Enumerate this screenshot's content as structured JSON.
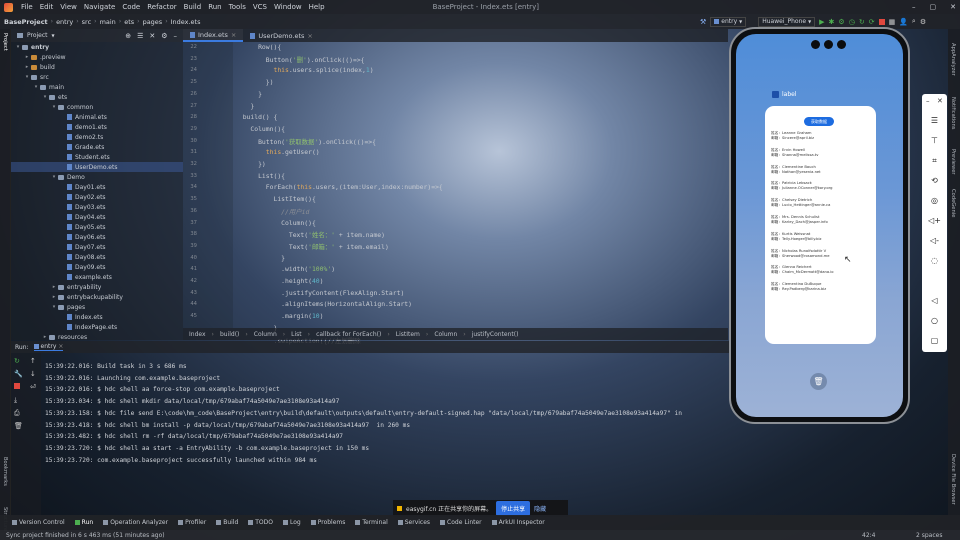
{
  "menubar": {
    "items": [
      "File",
      "Edit",
      "View",
      "Navigate",
      "Code",
      "Refactor",
      "Build",
      "Run",
      "Tools",
      "VCS",
      "Window",
      "Help"
    ],
    "title": "BaseProject - Index.ets [entry]"
  },
  "nav": {
    "crumbs": [
      "BaseProject",
      "entry",
      "src",
      "main",
      "ets",
      "pages",
      "Index.ets"
    ],
    "module": "entry",
    "device": "Huawei_Phone"
  },
  "project": {
    "label": "Project",
    "tree": [
      {
        "name": "entry",
        "depth": 0,
        "type": "folder",
        "open": true,
        "bold": true
      },
      {
        "name": ".preview",
        "depth": 1,
        "type": "folder",
        "orange": true
      },
      {
        "name": "build",
        "depth": 1,
        "type": "folder",
        "orange": true
      },
      {
        "name": "src",
        "depth": 1,
        "type": "folder",
        "open": true
      },
      {
        "name": "main",
        "depth": 2,
        "type": "folder",
        "open": true
      },
      {
        "name": "ets",
        "depth": 3,
        "type": "folder",
        "open": true
      },
      {
        "name": "common",
        "depth": 4,
        "type": "folder",
        "open": true
      },
      {
        "name": "Animal.ets",
        "depth": 5,
        "type": "file"
      },
      {
        "name": "demo1.ets",
        "depth": 5,
        "type": "file"
      },
      {
        "name": "demo2.ts",
        "depth": 5,
        "type": "file"
      },
      {
        "name": "Grade.ets",
        "depth": 5,
        "type": "file"
      },
      {
        "name": "Student.ets",
        "depth": 5,
        "type": "file"
      },
      {
        "name": "UserDemo.ets",
        "depth": 5,
        "type": "file",
        "selected": true
      },
      {
        "name": "Demo",
        "depth": 4,
        "type": "folder",
        "open": true
      },
      {
        "name": "Day01.ets",
        "depth": 5,
        "type": "file"
      },
      {
        "name": "Day02.ets",
        "depth": 5,
        "type": "file"
      },
      {
        "name": "Day03.ets",
        "depth": 5,
        "type": "file"
      },
      {
        "name": "Day04.ets",
        "depth": 5,
        "type": "file"
      },
      {
        "name": "Day05.ets",
        "depth": 5,
        "type": "file"
      },
      {
        "name": "Day06.ets",
        "depth": 5,
        "type": "file"
      },
      {
        "name": "Day07.ets",
        "depth": 5,
        "type": "file"
      },
      {
        "name": "Day08.ets",
        "depth": 5,
        "type": "file"
      },
      {
        "name": "Day09.ets",
        "depth": 5,
        "type": "file"
      },
      {
        "name": "example.ets",
        "depth": 5,
        "type": "file"
      },
      {
        "name": "entryability",
        "depth": 4,
        "type": "folder"
      },
      {
        "name": "entrybackupability",
        "depth": 4,
        "type": "folder"
      },
      {
        "name": "pages",
        "depth": 4,
        "type": "folder",
        "open": true
      },
      {
        "name": "Index.ets",
        "depth": 5,
        "type": "file"
      },
      {
        "name": "IndexPage.ets",
        "depth": 5,
        "type": "file"
      },
      {
        "name": "resources",
        "depth": 3,
        "type": "folder"
      }
    ]
  },
  "editor": {
    "tabs": [
      "Index.ets",
      "UserDemo.ets"
    ],
    "line_numbers": [
      "22",
      "23",
      "24",
      "25",
      "26",
      "27",
      "28",
      "29",
      "30",
      "31",
      "32",
      "33",
      "34",
      "35",
      "36",
      "37",
      "38",
      "39",
      "40",
      "41",
      "42",
      "43",
      "44",
      "45"
    ],
    "lines": [
      [
        {
          "t": "      Row(){",
          "c": ""
        }
      ],
      [
        {
          "t": "        Button(",
          "c": ""
        },
        {
          "t": "'删'",
          "c": "s"
        },
        {
          "t": ").onClick(()=>{",
          "c": ""
        }
      ],
      [
        {
          "t": "          ",
          "c": ""
        },
        {
          "t": "this",
          "c": "k"
        },
        {
          "t": ".users.splice(index,",
          "c": ""
        },
        {
          "t": "1",
          "c": "n"
        },
        {
          "t": ")",
          "c": ""
        }
      ],
      [
        {
          "t": "        })",
          "c": ""
        }
      ],
      [
        {
          "t": "      }",
          "c": ""
        }
      ],
      [
        {
          "t": "    }",
          "c": ""
        }
      ],
      [
        {
          "t": "  build() {",
          "c": ""
        }
      ],
      [
        {
          "t": "    Column(){",
          "c": ""
        }
      ],
      [
        {
          "t": "      Button(",
          "c": ""
        },
        {
          "t": "'获取数据'",
          "c": "s"
        },
        {
          "t": ").onClick(()=>{",
          "c": ""
        }
      ],
      [
        {
          "t": "        ",
          "c": ""
        },
        {
          "t": "this",
          "c": "k"
        },
        {
          "t": ".getUser()",
          "c": ""
        }
      ],
      [
        {
          "t": "      })",
          "c": ""
        }
      ],
      [
        {
          "t": "      List(){",
          "c": ""
        }
      ],
      [
        {
          "t": "        ForEach(",
          "c": ""
        },
        {
          "t": "this",
          "c": "k"
        },
        {
          "t": ".users,(item:User,index:number)=>{",
          "c": ""
        }
      ],
      [
        {
          "t": "          ListItem(){",
          "c": ""
        }
      ],
      [
        {
          "t": "            //用户id",
          "c": "c"
        }
      ],
      [
        {
          "t": "            Column(){",
          "c": ""
        }
      ],
      [
        {
          "t": "              Text(",
          "c": ""
        },
        {
          "t": "'姓名：'",
          "c": "s"
        },
        {
          "t": " + item.name)",
          "c": ""
        }
      ],
      [
        {
          "t": "              Text(",
          "c": ""
        },
        {
          "t": "'邮箱：'",
          "c": "s"
        },
        {
          "t": " + item.email)",
          "c": ""
        }
      ],
      [
        {
          "t": "            }",
          "c": ""
        }
      ],
      [
        {
          "t": "            .width(",
          "c": ""
        },
        {
          "t": "'100%'",
          "c": "s"
        },
        {
          "t": ")",
          "c": ""
        }
      ],
      [
        {
          "t": "            .height(",
          "c": ""
        },
        {
          "t": "40",
          "c": "n"
        },
        {
          "t": ")",
          "c": ""
        }
      ],
      [
        {
          "t": "            .justifyContent(FlexAlign.Start)",
          "c": ""
        }
      ],
      [
        {
          "t": "            .alignItems(HorizontalAlign.Start)",
          "c": ""
        }
      ],
      [
        {
          "t": "            .margin(",
          "c": ""
        },
        {
          "t": "10",
          "c": "n"
        },
        {
          "t": ")",
          "c": ""
        }
      ],
      [
        {
          "t": "          }",
          "c": ""
        }
      ],
      [
        {
          "t": "          .swipeAction({//左划删除",
          "c": ""
        }
      ]
    ],
    "breadcrumb": [
      "Index",
      "build()",
      "Column",
      "List",
      "callback for ForEach()",
      "ListItem",
      "Column",
      "justifyContent()"
    ]
  },
  "run": {
    "label": "Run:",
    "config": "entry",
    "lines": [
      "15:39:22.016: Build task in 3 s 686 ms",
      "15:39:22.016: Launching com.example.baseproject",
      "15:39:22.016: $ hdc shell aa force-stop com.example.baseproject",
      "15:39:23.034: $ hdc shell mkdir data/local/tmp/679abaf74a5049e7ae3108e93a414a97",
      "15:39:23.158: $ hdc file send E:\\code\\hm_code\\BaseProject\\entry\\build\\default\\outputs\\default\\entry-default-signed.hap \"data/local/tmp/679abaf74a5049e7ae3108e93a414a97\" in",
      "15:39:23.418: $ hdc shell bm install -p data/local/tmp/679abaf74a5049e7ae3108e93a414a97  in 260 ms",
      "15:39:23.482: $ hdc shell rm -rf data/local/tmp/679abaf74a5049e7ae3108e93a414a97",
      "15:39:23.720: $ hdc shell aa start -a EntryAbility -b com.example.baseproject in 150 ms",
      "15:39:23.720: com.example.baseproject successfully launched within 984 ms"
    ]
  },
  "tools": [
    "Version Control",
    "Run",
    "Operation Analyzer",
    "Profiler",
    "Build",
    "TODO",
    "Log",
    "Problems",
    "Terminal",
    "Services",
    "Code Linter",
    "ArkUI Inspector"
  ],
  "status": {
    "text": "Sync project finished in 6 s 463 ms (51 minutes ago)",
    "pos": "42:4",
    "indent": "2 spaces"
  },
  "right_strip": [
    "AppAnalyzer",
    "Notifications",
    "Previewer",
    "CodeGenie"
  ],
  "right_strip_bottom": "Device File Browser",
  "left_strip": [
    "Project",
    "Bookmarks",
    "Structure"
  ],
  "phone": {
    "app_label": "label",
    "button": "获取数据",
    "users": [
      {
        "name": "姓名：Leanne Graham",
        "email": "邮箱：Sincere@april.biz"
      },
      {
        "name": "姓名：Ervin Howell",
        "email": "邮箱：Shanna@melissa.tv"
      },
      {
        "name": "姓名：Clementine Bauch",
        "email": "邮箱：Nathan@yesenia.net"
      },
      {
        "name": "姓名：Patricia Lebsack",
        "email": "邮箱：Julianne.OConner@kory.org"
      },
      {
        "name": "姓名：Chelsey Dietrich",
        "email": "邮箱：Lucio_Hettinger@annie.ca"
      },
      {
        "name": "姓名：Mrs. Dennis Schulist",
        "email": "邮箱：Karley_Dach@jasper.info"
      },
      {
        "name": "姓名：Kurtis Weissnat",
        "email": "邮箱：Telly.Hoeger@billy.biz"
      },
      {
        "name": "姓名：Nicholas Runolfsdottir V",
        "email": "邮箱：Sherwood@rosamond.me"
      },
      {
        "name": "姓名：Glenna Reichert",
        "email": "邮箱：Chaim_McDermott@dana.io"
      },
      {
        "name": "姓名：Clementina DuBuque",
        "email": "邮箱：Rey.Padberg@karina.biz"
      }
    ]
  },
  "share": {
    "text": "easygif.cn 正在共享你的屏幕。",
    "stop": "停止共享",
    "hide": "隐藏"
  },
  "colors": {
    "accent": "#3b7be0",
    "phone_button": "#1d6ce0",
    "selection": "#3c5a96"
  }
}
